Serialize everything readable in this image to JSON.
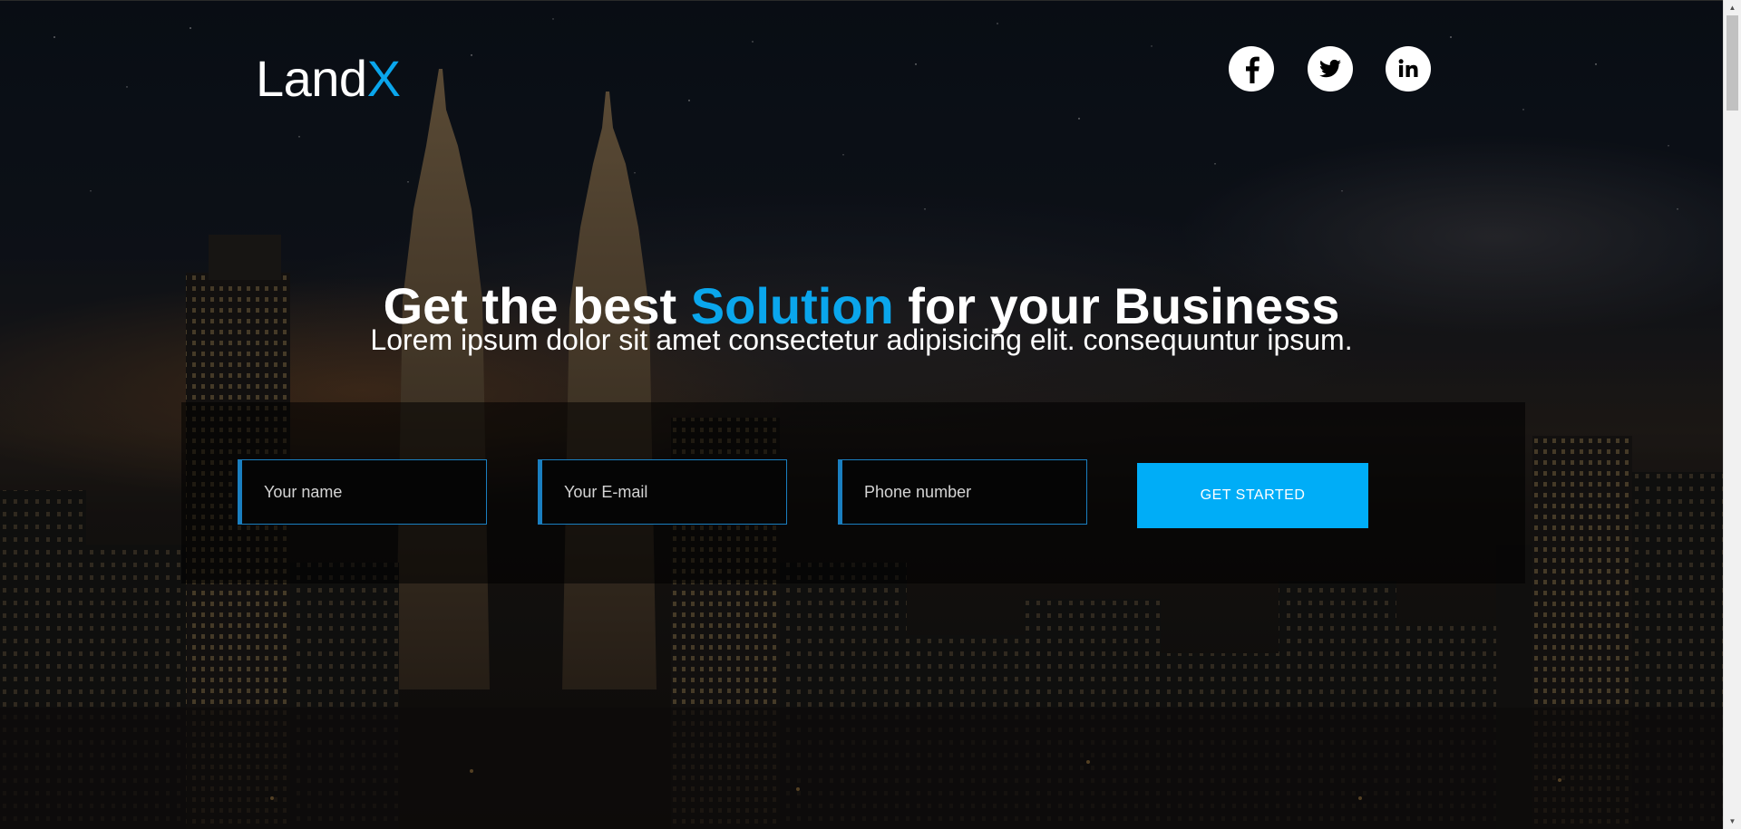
{
  "brand": {
    "name": "Land",
    "accent": "X",
    "accent_color": "#0aa6ec"
  },
  "social": [
    {
      "name": "facebook",
      "icon": "facebook-icon"
    },
    {
      "name": "twitter",
      "icon": "twitter-icon"
    },
    {
      "name": "linkedin",
      "icon": "linkedin-icon"
    }
  ],
  "hero": {
    "title_part1": "Get the best ",
    "title_highlight": "Solution",
    "title_part2": " for your ",
    "title_bold": "Business",
    "subtitle": "Lorem ipsum dolor sit amet consectetur adipisicing elit. consequuntur ipsum."
  },
  "form": {
    "name_placeholder": "Your name",
    "email_placeholder": "Your E-mail",
    "phone_placeholder": "Phone number",
    "submit_label": "GET STARTED"
  },
  "colors": {
    "accent": "#0aa6ec",
    "button": "#00adf7",
    "field_border": "#1a7fc0"
  }
}
